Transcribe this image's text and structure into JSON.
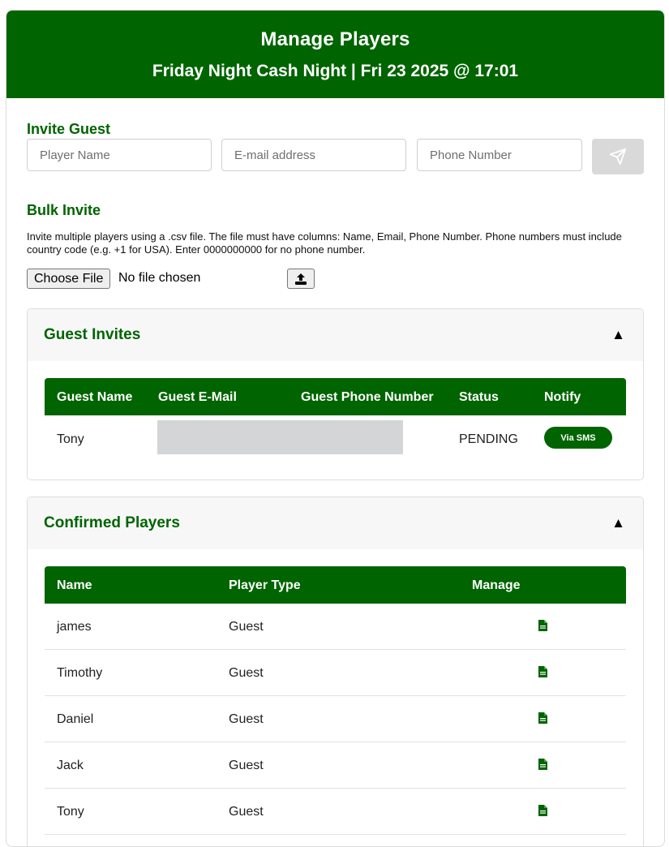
{
  "header": {
    "title": "Manage Players",
    "subtitle": "Friday Night Cash Night | Fri 23 2025 @ 17:01"
  },
  "invite_guest": {
    "title": "Invite Guest",
    "name_placeholder": "Player Name",
    "email_placeholder": "E-mail address",
    "phone_placeholder": "Phone Number",
    "send_icon": "paper-plane-icon"
  },
  "bulk_invite": {
    "title": "Bulk Invite",
    "description": "Invite multiple players using a .csv file. The file must have columns: Name, Email, Phone Number. Phone numbers must include country code (e.g. +1 for USA). Enter 0000000000 for no phone number.",
    "choose_file_label": "Choose File",
    "file_status": "No file chosen",
    "upload_icon": "upload-icon"
  },
  "guest_invites": {
    "title": "Guest Invites",
    "toggle": "▲",
    "columns": [
      "Guest Name",
      "Guest E-Mail",
      "Guest Phone Number",
      "Status",
      "Notify"
    ],
    "rows": [
      {
        "name": "Tony",
        "email": "",
        "phone": "",
        "status": "PENDING",
        "notify": "Via SMS"
      }
    ]
  },
  "confirmed_players": {
    "title": "Confirmed Players",
    "toggle": "▲",
    "columns": [
      "Name",
      "Player Type",
      "Manage"
    ],
    "rows": [
      {
        "name": "james",
        "type": "Guest",
        "manage_icon": "document-icon"
      },
      {
        "name": "Timothy",
        "type": "Guest",
        "manage_icon": "document-icon"
      },
      {
        "name": "Daniel",
        "type": "Guest",
        "manage_icon": "document-icon"
      },
      {
        "name": "Jack",
        "type": "Guest",
        "manage_icon": "document-icon"
      },
      {
        "name": "Tony",
        "type": "Guest",
        "manage_icon": "document-icon"
      }
    ]
  },
  "colors": {
    "brand_green": "#006400",
    "panel_bg": "#f7f7f8",
    "redaction": "#d4d5d7"
  }
}
